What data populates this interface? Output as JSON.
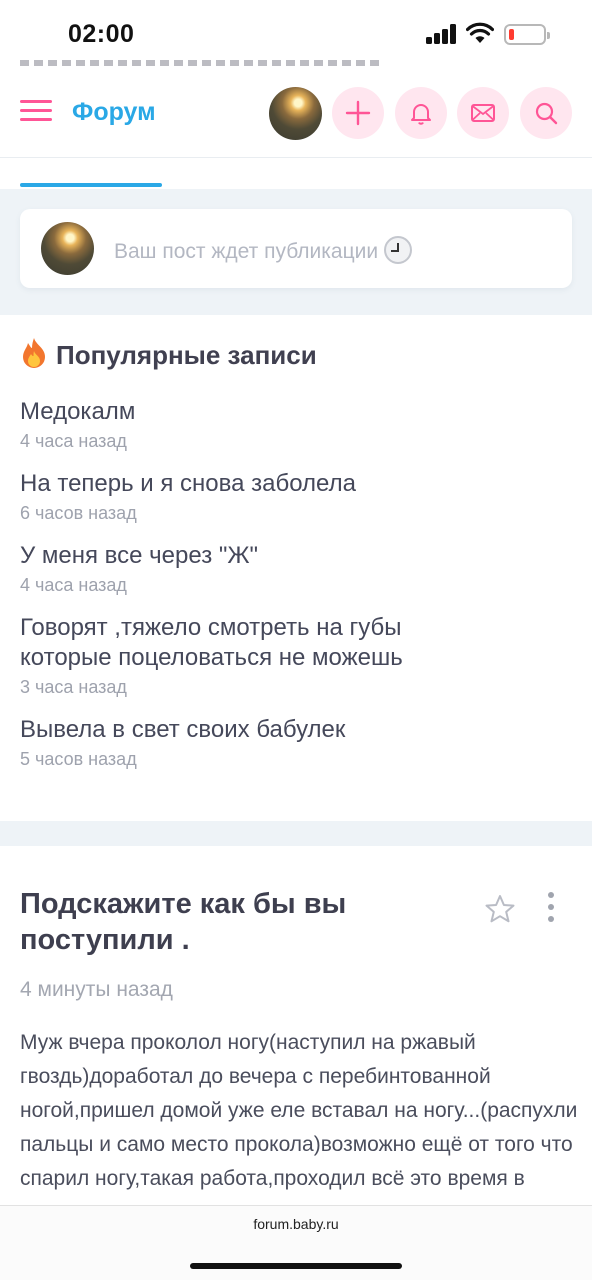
{
  "status_bar": {
    "time": "02:00",
    "battery_level": 0.15
  },
  "header": {
    "brand": "Форум",
    "buttons": [
      "plus-icon",
      "bell-icon",
      "mail-icon",
      "search-icon"
    ]
  },
  "pending": {
    "text": "Ваш пост ждет публикации"
  },
  "popular": {
    "title": "Популярные записи",
    "items": [
      {
        "title": "Медокалм",
        "time": "4 часа назад"
      },
      {
        "title": "На теперь и я снова заболела",
        "time": "6 часов назад"
      },
      {
        "title": "У меня все через \"Ж\"",
        "time": "4 часа назад"
      },
      {
        "title": "Говорят ,тяжело смотреть на губы которые поцеловаться не можешь",
        "time": "3 часа назад"
      },
      {
        "title": "Вывела в свет своих бабулек",
        "time": "5 часов назад"
      }
    ]
  },
  "post": {
    "title": "Подскажите как бы вы поступили .",
    "time": "4 минуты назад",
    "body": "Муж вчера проколол ногу(наступил на ржавый гвоздь)доработал до вечера с перебинтованной ногой,пришел домой уже еле вставал на ногу...(распухли пальцы и само место прокола)возможно ещё от того что спарил ногу,такая работа,проходил всё это время в"
  },
  "browser": {
    "url": "forum.baby.ru"
  },
  "colors": {
    "accent_pink": "#ff5596",
    "accent_blue": "#2aa8e6",
    "band": "#eef3f7"
  }
}
